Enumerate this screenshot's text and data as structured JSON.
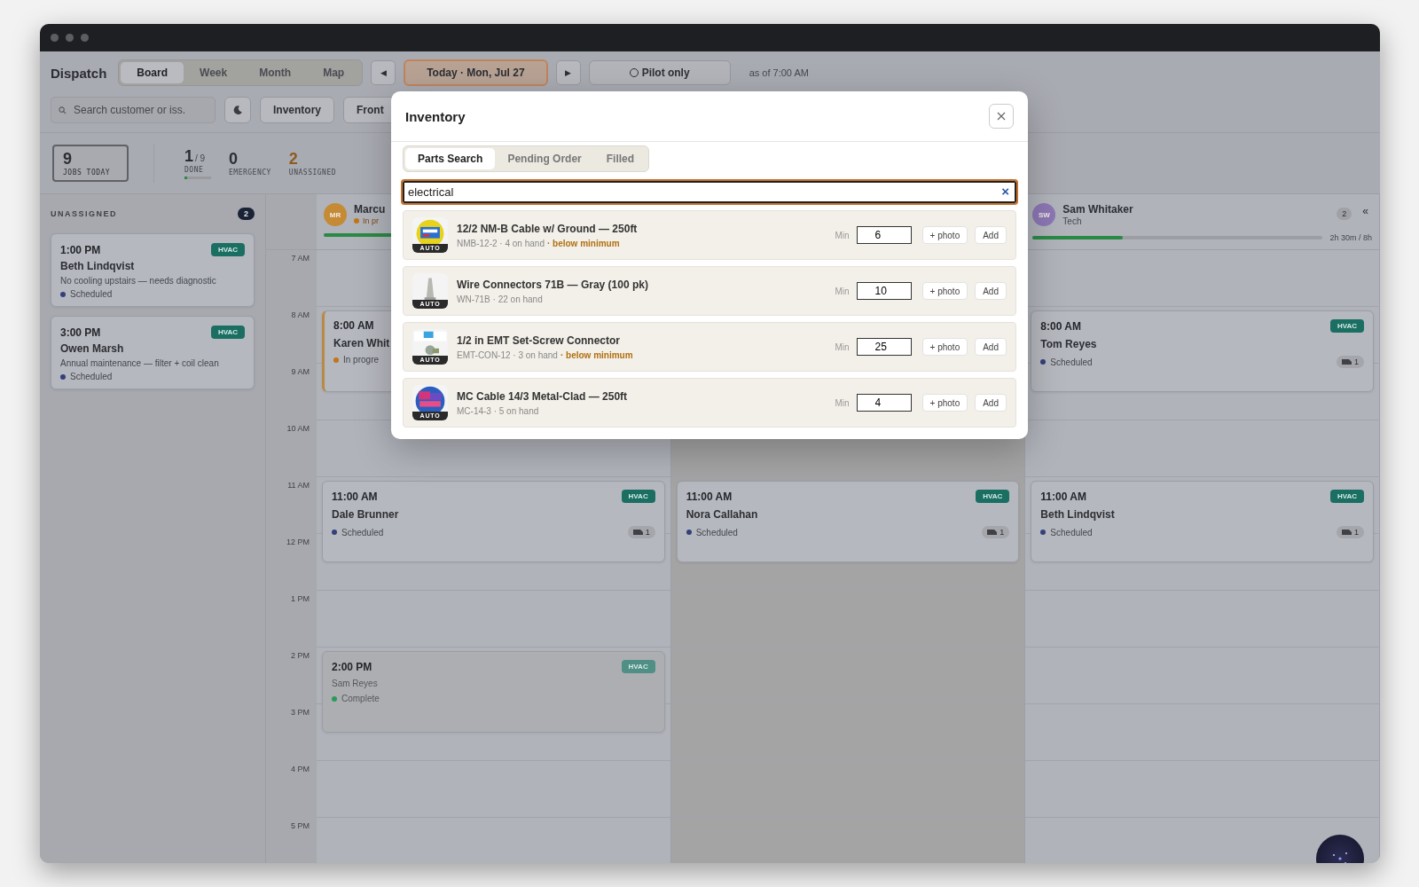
{
  "header": {
    "title": "Dispatch",
    "views": [
      {
        "label": "Board",
        "selected": true
      },
      {
        "label": "Week",
        "selected": false
      },
      {
        "label": "Month",
        "selected": false
      },
      {
        "label": "Map",
        "selected": false
      }
    ],
    "prev": "◀",
    "date": "Today · Mon, Jul 27",
    "next": "▶",
    "pilot": "Pilot only",
    "as_of": "as of 7:00 AM"
  },
  "toolbar": {
    "search_placeholder": "Search customer or iss.",
    "buttons": [
      "Inventory",
      "Front"
    ]
  },
  "stats": [
    {
      "kind": "boxed",
      "value": "9",
      "label": "JOBS TODAY"
    },
    {
      "kind": "progress",
      "value": "1",
      "total": "/ 9",
      "label": "DONE",
      "level": 0.11
    },
    {
      "kind": "plain",
      "value": "0",
      "label": "EMERGENCY"
    },
    {
      "kind": "warning",
      "value": "2",
      "label": "UNASSIGNED"
    }
  ],
  "unassigned": {
    "title": "UNASSIGNED",
    "count": "2",
    "jobs": [
      {
        "time": "1:00 PM",
        "customer": "Beth Lindqvist",
        "note": "No cooling upstairs — needs diagnostic",
        "status": "Scheduled",
        "color": "#34407a",
        "tag": "HVAC"
      },
      {
        "time": "3:00 PM",
        "customer": "Owen Marsh",
        "note": "Annual maintenance — filter + coil clean",
        "status": "Scheduled",
        "color": "#34407a",
        "tag": "HVAC"
      }
    ]
  },
  "hours": [
    "7 AM",
    "8 AM",
    "9 AM",
    "10 AM",
    "11 AM",
    "12 PM",
    "1 PM",
    "2 PM",
    "3 PM",
    "4 PM",
    "5 PM"
  ],
  "techs": [
    {
      "off": false,
      "initials": "MR",
      "color": "#c48a35",
      "name": "Marcu",
      "status": "In pr",
      "level": 0.2,
      "jobs": [
        {
          "kind": "in_progress",
          "time": "8:00 AM",
          "customer": "Karen Whit",
          "status": "In progre",
          "color": "#c47318"
        },
        {
          "kind": "scheduled",
          "time": "11:00 AM",
          "customer": "Dale Brunner",
          "status": "Scheduled",
          "color": "#34407a",
          "tag": "HVAC",
          "vehicles": "1"
        },
        {
          "kind": "complete",
          "time": "2:00 PM",
          "customer": "Sam Reyes",
          "status": "Complete",
          "color": "#2c9a5a",
          "tag": "HVAC"
        }
      ]
    },
    {
      "off": true,
      "jobs": [
        {
          "kind": "scheduled",
          "time": "11:00 AM",
          "customer": "Nora Callahan",
          "status": "Scheduled",
          "color": "#34407a",
          "tag": "HVAC",
          "vehicles": "1"
        }
      ]
    },
    {
      "off": false,
      "initials": "SW",
      "color": "#8c77b4",
      "name": "Sam Whitaker",
      "subtitle": "Tech",
      "count": "2",
      "collapse": "«",
      "level": 0.31,
      "hours_text": "2h 30m / 8h",
      "jobs": [
        {
          "kind": "scheduled",
          "time": "8:00 AM",
          "customer": "Tom Reyes",
          "status": "Scheduled",
          "color": "#34407a",
          "tag": "HVAC",
          "vehicles": "1"
        },
        {
          "kind": "scheduled",
          "time": "11:00 AM",
          "customer": "Beth Lindqvist",
          "status": "Scheduled",
          "color": "#34407a",
          "tag": "HVAC",
          "vehicles": "1"
        }
      ]
    }
  ],
  "modal": {
    "title": "Inventory",
    "tabs": [
      {
        "label": "Parts Search",
        "selected": true
      },
      {
        "label": "Pending Order",
        "selected": false
      },
      {
        "label": "Filled",
        "selected": false
      }
    ],
    "search": {
      "value": "electrical",
      "clear": "×"
    },
    "parts": [
      {
        "name": "12/2 NM-B Cable w/ Ground — 250ft",
        "meta": "NMB-12-2 · 4 on hand",
        "warning": "· below minimum",
        "badge": "AUTO",
        "min_label": "Min",
        "min": "6",
        "photo": "+ photo",
        "add": "Add"
      },
      {
        "name": "Wire Connectors 71B — Gray (100 pk)",
        "meta": "WN-71B · 22 on hand",
        "badge": "AUTO",
        "min_label": "Min",
        "min": "10",
        "photo": "+ photo",
        "add": "Add"
      },
      {
        "name": "1/2 in EMT Set-Screw Connector",
        "meta": "EMT-CON-12 · 3 on hand",
        "warning": "· below minimum",
        "badge": "AUTO",
        "min_label": "Min",
        "min": "25",
        "photo": "+ photo",
        "add": "Add"
      },
      {
        "name": "MC Cable 14/3 Metal-Clad — 250ft",
        "meta": "MC-14-3 · 5 on hand",
        "badge": "AUTO",
        "min_label": "Min",
        "min": "4",
        "photo": "+ photo",
        "add": "Add"
      }
    ]
  }
}
